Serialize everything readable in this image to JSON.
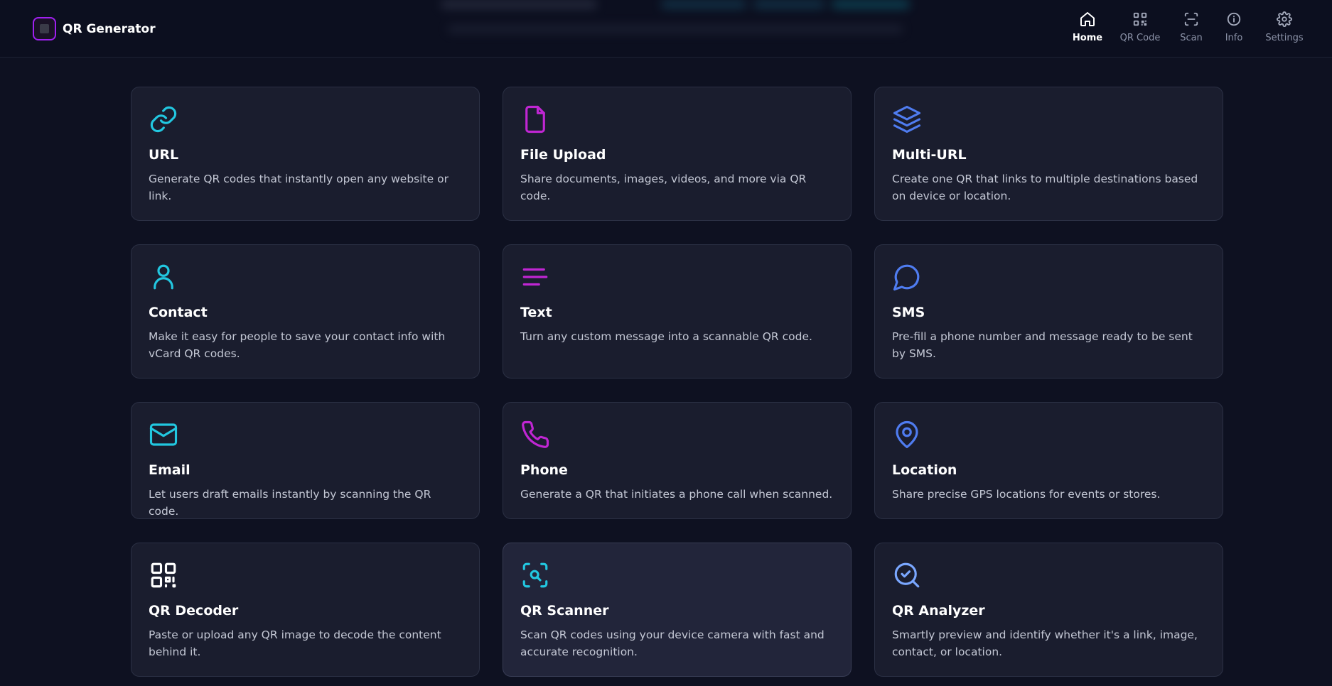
{
  "app": {
    "title": "QR Generator"
  },
  "nav": [
    {
      "label": "Home",
      "icon": "home-icon",
      "active": true
    },
    {
      "label": "QR Code",
      "icon": "qr-code-icon",
      "active": false
    },
    {
      "label": "Scan",
      "icon": "scan-icon",
      "active": false
    },
    {
      "label": "Info",
      "icon": "info-icon",
      "active": false
    },
    {
      "label": "Settings",
      "icon": "gear-icon",
      "active": false
    }
  ],
  "cards": [
    {
      "title": "URL",
      "description": "Generate QR codes that instantly open any website or link.",
      "icon": "link-icon",
      "color": "#22c7e0"
    },
    {
      "title": "File Upload",
      "description": "Share documents, images, videos, and more via QR code.",
      "icon": "file-icon",
      "color": "#c026d3"
    },
    {
      "title": "Multi-URL",
      "description": "Create one QR that links to multiple destinations based on device or location.",
      "icon": "layers-icon",
      "color": "#4f7cf0"
    },
    {
      "title": "Contact",
      "description": "Make it easy for people to save your contact info with vCard QR codes.",
      "icon": "user-icon",
      "color": "#22c7e0"
    },
    {
      "title": "Text",
      "description": "Turn any custom message into a scannable QR code.",
      "icon": "text-lines-icon",
      "color": "#c026d3"
    },
    {
      "title": "SMS",
      "description": "Pre-fill a phone number and message ready to be sent by SMS.",
      "icon": "message-bubble-icon",
      "color": "#4f7cf0"
    },
    {
      "title": "Email",
      "description": "Let users draft emails instantly by scanning the QR code.",
      "icon": "mail-icon",
      "color": "#22c7e0"
    },
    {
      "title": "Phone",
      "description": "Generate a QR that initiates a phone call when scanned.",
      "icon": "phone-icon",
      "color": "#c026d3"
    },
    {
      "title": "Location",
      "description": "Share precise GPS locations for events or stores.",
      "icon": "map-pin-icon",
      "color": "#4f7cf0"
    },
    {
      "title": "QR Decoder",
      "description": "Paste or upload any QR image to decode the content behind it.",
      "icon": "qr-code-icon",
      "color": "#ffffff"
    },
    {
      "title": "QR Scanner",
      "description": "Scan QR codes using your device camera with fast and accurate recognition.",
      "icon": "scan-search-icon",
      "color": "#22c7e0"
    },
    {
      "title": "QR Analyzer",
      "description": "Smartly preview and identify whether it's a link, image, contact, or location.",
      "icon": "search-check-icon",
      "color": "#7aa7ff"
    }
  ],
  "colors": {
    "background": "#0e1121",
    "card": "#1a1d2e",
    "brand_border": "#a020f0"
  }
}
